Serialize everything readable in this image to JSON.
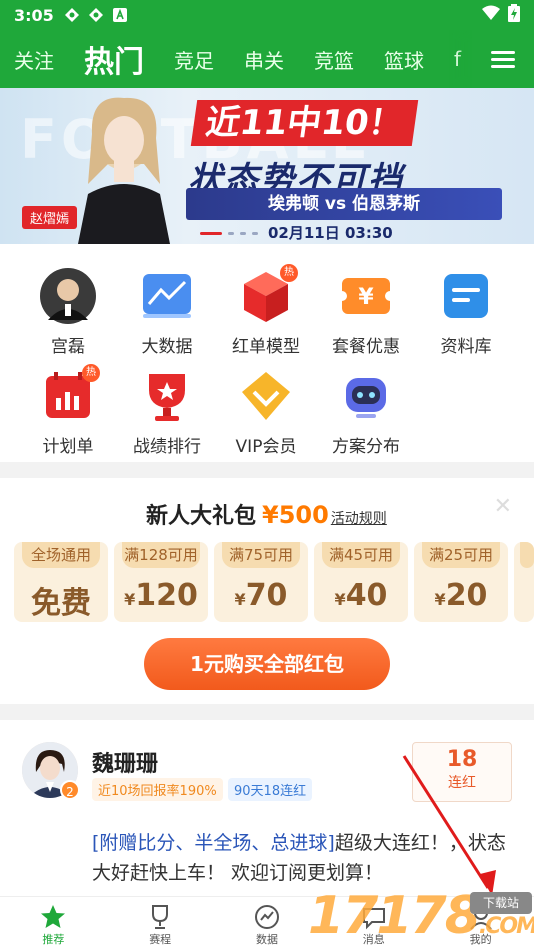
{
  "status": {
    "time": "3:05"
  },
  "topnav": {
    "tabs": [
      "关注",
      "热门",
      "竞足",
      "串关",
      "竞篮",
      "篮球",
      "f"
    ],
    "active_index": 1
  },
  "banner": {
    "ghost_text": "FOOTBALL",
    "name": "赵熠嫣",
    "headline1": "近11中10！",
    "headline2": "状态势不可挡",
    "match": "埃弗顿 vs 伯恩茅斯",
    "date": "02月11日 03:30"
  },
  "grid": [
    {
      "label": "宫磊",
      "icon": "avatar-icon",
      "hot": ""
    },
    {
      "label": "大数据",
      "icon": "chart-icon",
      "hot": ""
    },
    {
      "label": "红单模型",
      "icon": "cube-icon",
      "hot": "热"
    },
    {
      "label": "套餐优惠",
      "icon": "ticket-icon",
      "hot": ""
    },
    {
      "label": "资料库",
      "icon": "document-icon",
      "hot": ""
    },
    {
      "label": "计划单",
      "icon": "calendar-chart-icon",
      "hot": "热"
    },
    {
      "label": "战绩排行",
      "icon": "trophy-icon",
      "hot": ""
    },
    {
      "label": "VIP会员",
      "icon": "vip-diamond-icon",
      "hot": ""
    },
    {
      "label": "方案分布",
      "icon": "robot-icon",
      "hot": ""
    }
  ],
  "gift": {
    "title": "新人大礼包",
    "amount": "¥500",
    "rules": "活动规则",
    "coupons": [
      {
        "cap": "全场通用",
        "value": "免费",
        "currency": ""
      },
      {
        "cap": "满128可用",
        "value": "120",
        "currency": "¥"
      },
      {
        "cap": "满75可用",
        "value": "70",
        "currency": "¥"
      },
      {
        "cap": "满45可用",
        "value": "40",
        "currency": "¥"
      },
      {
        "cap": "满25可用",
        "value": "20",
        "currency": "¥"
      }
    ],
    "buy_button": "1元购买全部红包"
  },
  "expert": {
    "name": "魏珊珊",
    "level": "2",
    "tag_return": "近10场回报率190%",
    "tag_streak": "90天18连红",
    "streak_num": "18",
    "streak_label": "连红",
    "desc_highlight": "[附赠比分、半全场、总进球]",
    "desc_rest": "超级大连红！，状态大好赶快上车！ 欢迎订阅更划算！"
  },
  "bottomnav": [
    {
      "label": "推荐",
      "icon": "star-icon",
      "active": true
    },
    {
      "label": "赛程",
      "icon": "trophy-cup-icon",
      "active": false
    },
    {
      "label": "数据",
      "icon": "trend-icon",
      "active": false
    },
    {
      "label": "消息",
      "icon": "message-icon",
      "active": false
    },
    {
      "label": "我的",
      "icon": "user-icon",
      "active": false
    }
  ],
  "watermark": {
    "text": "17178",
    "suffix": ".COM",
    "download": "下载站"
  },
  "colors": {
    "brand": "#1fa83a",
    "accent": "#ff7a00",
    "red": "#e1262a"
  }
}
